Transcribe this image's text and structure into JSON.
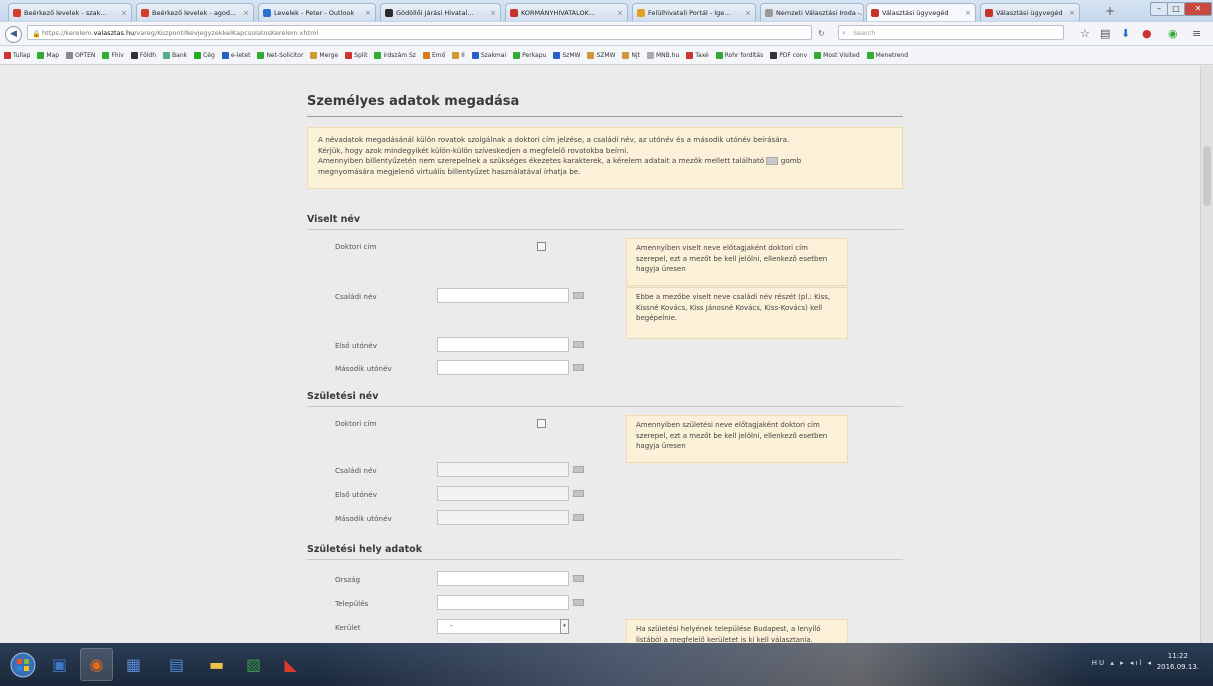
{
  "browser": {
    "tabs": [
      {
        "label": "Beérkező levelek - szak...",
        "color": "#d63b2f"
      },
      {
        "label": "Beérkező levelek - agod...",
        "color": "#d63b2f"
      },
      {
        "label": "Levelek - Peter - Outlook",
        "color": "#2a6fd1"
      },
      {
        "label": "Gödöllői Járási Hivatal...",
        "color": "#2c2c2c"
      },
      {
        "label": "KORMÁNYHIVATALOK...",
        "color": "#c8322c"
      },
      {
        "label": "Felülhivatali Portál - Ige...",
        "color": "#e0a020"
      },
      {
        "label": "Nemzeti Választási Iroda -...",
        "color": "#999999"
      },
      {
        "label": "Választási ügyvegéd",
        "color": "#c8322c"
      },
      {
        "label": "Választási ügyvegéd",
        "color": "#c8322c"
      }
    ],
    "active_tab": 7,
    "new_tab": "+",
    "url_prefix": "https://kerelem.",
    "url_domain": "valasztas.hu",
    "url_rest": "/vareg/KozpontiNevjegyzekkelKapcsolatosKerelem.xhtml",
    "search_placeholder": "Search",
    "bookmarks": [
      {
        "label": "Tullap",
        "color": "#c33"
      },
      {
        "label": "Map",
        "color": "#3a3"
      },
      {
        "label": "OPTEN",
        "color": "#888"
      },
      {
        "label": "Fhiv",
        "color": "#3a3"
      },
      {
        "label": "Földh",
        "color": "#333"
      },
      {
        "label": "Bank",
        "color": "#5a8"
      },
      {
        "label": "Cég",
        "color": "#2a2"
      },
      {
        "label": "e-letet",
        "color": "#2a5fc8"
      },
      {
        "label": "Net-Solicitor",
        "color": "#3a3"
      },
      {
        "label": "Merge",
        "color": "#c93"
      },
      {
        "label": "Split",
        "color": "#c33"
      },
      {
        "label": "irdszám Sz",
        "color": "#3a3"
      },
      {
        "label": "Emő",
        "color": "#d8791a"
      },
      {
        "label": "II",
        "color": "#c93"
      },
      {
        "label": "Szakmai",
        "color": "#2a5fc8"
      },
      {
        "label": "Perkapu",
        "color": "#3a3"
      },
      {
        "label": "SzMW",
        "color": "#2a5fc8"
      },
      {
        "label": "SZMW",
        "color": "#c93"
      },
      {
        "label": "Njt",
        "color": "#c93"
      },
      {
        "label": "MNB.hu",
        "color": "#aaa"
      },
      {
        "label": "Taxé",
        "color": "#c33"
      },
      {
        "label": "Rohr fordítás",
        "color": "#3a3"
      },
      {
        "label": "PDF conv",
        "color": "#333"
      },
      {
        "label": "Most Visited",
        "color": "#3a3"
      },
      {
        "label": "Menetrend",
        "color": "#3a3"
      }
    ]
  },
  "page": {
    "title": "Személyes adatok megadása",
    "info": {
      "line1": "A névadatok megadásánál külön rovatok szolgálnak a doktori cím jelzése, a családi név, az utónév és a második utónév beírására.",
      "line2": "Kérjük, hogy azok mindegyikét külön-külön szíveskedjen a megfelelő rovatokba beírni.",
      "line3a": "Amennyiben billentyűzetén nem szerepelnek a szükséges ékezetes karakterek, a kérelem adatait a mezők mellett található",
      "line3b": "gomb",
      "line4": "megnyomására megjelenő virtuális billentyűzet használatával írhatja be."
    },
    "viselt": {
      "title": "Viselt név",
      "doktori_label": "Doktori cím",
      "doktori_tip": "Amennyiben viselt neve előtagjaként doktori cím szerepel, ezt a mezőt be kell jelölni, ellenkező esetben hagyja üresen",
      "csaladi_label": "Családi név",
      "csaladi_value": "",
      "csaladi_tip": "Ebbe a mezőbe viselt neve családi név részét (pl.: Kiss, Kissné Kovács, Kiss Jánosné Kovács, Kiss-Kovács) kell begépelnie.",
      "elso_label": "Első utónév",
      "elso_value": "",
      "masodik_label": "Második utónév",
      "masodik_value": ""
    },
    "szuletesi": {
      "title": "Születési név",
      "doktori_label": "Doktori cím",
      "doktori_tip": "Amennyiben születési neve előtagjaként doktori cím szerepel, ezt a mezőt be kell jelölni, ellenkező esetben hagyja üresen",
      "csaladi_label": "Családi név",
      "csaladi_value": "",
      "elso_label": "Első utónév",
      "elso_value": "",
      "masodik_label": "Második utónév",
      "masodik_value": ""
    },
    "hely": {
      "title": "Születési hely adatok",
      "orszag_label": "Ország",
      "orszag_value": "",
      "telepules_label": "Település",
      "telepules_value": "",
      "kerulet_label": "Kerület",
      "kerulet_value": "-",
      "kerulet_tip": "Ha születési helyének települése Budapest, a lenyíló listából a megfelelő kerületet is ki kell választania."
    }
  },
  "taskbar": {
    "tray": "HU ▴ ▸ ◂ıl ◂",
    "time": "11:22",
    "date": "2016.09.13."
  }
}
